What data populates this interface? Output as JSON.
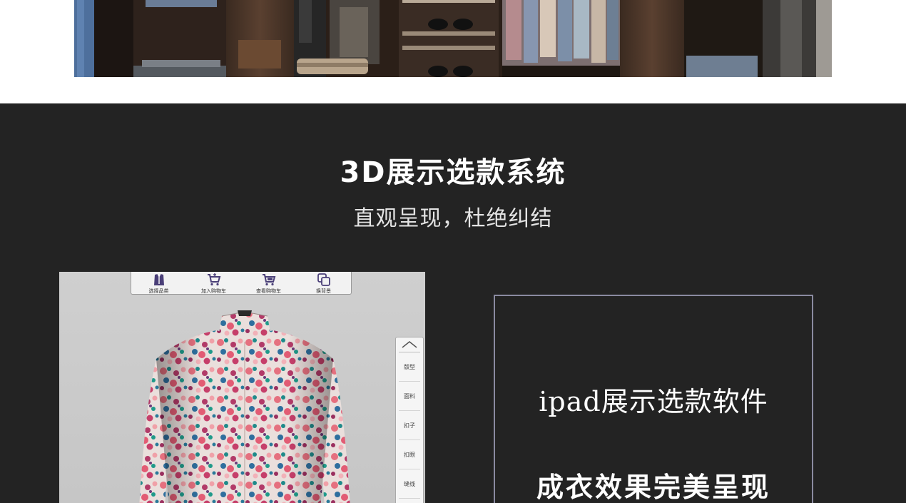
{
  "banner": {
    "image": "wardrobe-photo"
  },
  "section": {
    "title": "3D展示选款系统",
    "subtitle": "直观呈现，杜绝纠结"
  },
  "app": {
    "toolbar": [
      {
        "label": "选择品类",
        "icon": "suit-icon"
      },
      {
        "label": "加入购物车",
        "icon": "cart-add-icon"
      },
      {
        "label": "查看购物车",
        "icon": "cart-view-icon"
      },
      {
        "label": "换背景",
        "icon": "background-icon"
      }
    ],
    "side_menu": [
      "版型",
      "面料",
      "扣子",
      "扣眼",
      "缝线"
    ],
    "garment": "floral-shirt"
  },
  "feature": {
    "line1": "ipad展示选款软件",
    "line2": "成衣效果完美呈现"
  },
  "colors": {
    "section_bg": "#232323",
    "frame_border": "#8a8aa0",
    "text": "#ffffff"
  }
}
